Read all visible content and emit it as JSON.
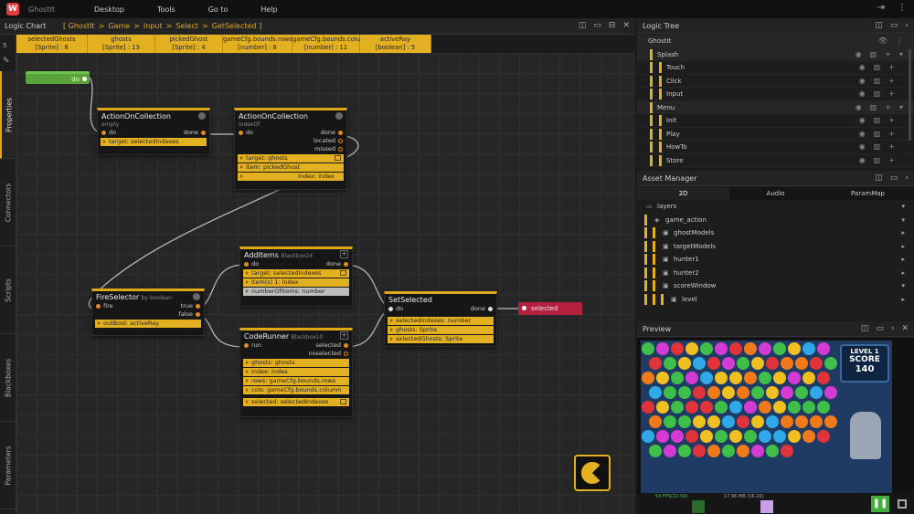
{
  "app": {
    "name": "GhostIt",
    "logo_letter": "W"
  },
  "menu": [
    "Desktop",
    "Tools",
    "Go to",
    "Help"
  ],
  "logic_chart": {
    "title": "Logic Chart",
    "breadcrumb": [
      "[ GhostIt",
      ">",
      "Game",
      ">",
      "Input",
      ">",
      "Select",
      ">",
      "GetSelected ]"
    ]
  },
  "left_tabs": [
    "Properties",
    "Connectors",
    "Scripts",
    "Blackboxes",
    "Parameters"
  ],
  "vars_counter": "5",
  "variables": [
    {
      "name": "selectedGhosts",
      "type": "[Sprite] : 8"
    },
    {
      "name": "ghosts",
      "type": "[Sprite] : 13"
    },
    {
      "name": "pickedGhost",
      "type": "[Sprite] : 4"
    },
    {
      "name": "gameCfg.bounds.rows",
      "type": "[number] : 8"
    },
    {
      "name": "gameCfg.bounds.colu",
      "type": "[number] : 11"
    },
    {
      "name": "activeRay",
      "type": "[boolean] : 5"
    }
  ],
  "nodes": {
    "do": "do",
    "aoc1": {
      "title": "ActionOnCollection",
      "sub": "empty",
      "in": "do",
      "out": "done",
      "param": "target: selectedIndexes"
    },
    "aoc2": {
      "title": "ActionOnCollection",
      "sub": "indexOf",
      "in": "do",
      "outs": [
        "done",
        "located",
        "missed"
      ],
      "params": [
        "target: ghosts",
        "item: pickedGhost"
      ],
      "out_param": "index: index"
    },
    "fire": {
      "title": "FireSelector",
      "sub": "by boolean",
      "in": "fire",
      "outs": [
        "true",
        "false"
      ],
      "param": "outBool: activeRay"
    },
    "additems": {
      "title": "AddItems",
      "sub": "Blackbox24",
      "in": "do",
      "out": "done",
      "params": [
        "target: selectedIndexes",
        "item(s) 1: index"
      ],
      "grey": "numberOfItems: number"
    },
    "coderunner": {
      "title": "CodeRunner",
      "sub": "Blackbox10",
      "in": "run",
      "outs": [
        "selected",
        "noselected"
      ],
      "params": [
        "ghosts: ghosts",
        "index: index",
        "rows: gameCfg.bounds.rows",
        "cols: gameCfg.bounds.column"
      ],
      "out_param": "selected: selectedIndexes"
    },
    "setselected": {
      "title": "SetSelected",
      "in": "do",
      "out": "done",
      "params": [
        "selectedIndexes: number",
        "ghosts: Sprite",
        "selectedGhosts: Sprite"
      ]
    },
    "selected": "selected"
  },
  "logic_tree": {
    "title": "Logic Tree",
    "rows": [
      {
        "label": "GhostIt",
        "level": 0,
        "folder": true
      },
      {
        "label": "Splash",
        "level": 1,
        "folder": true
      },
      {
        "label": "Touch",
        "level": 2
      },
      {
        "label": "Click",
        "level": 2
      },
      {
        "label": "Input",
        "level": 2
      },
      {
        "label": "Menu",
        "level": 1,
        "folder": true
      },
      {
        "label": "Init",
        "level": 2
      },
      {
        "label": "Play",
        "level": 2
      },
      {
        "label": "HowTo",
        "level": 2
      },
      {
        "label": "Store",
        "level": 2
      }
    ]
  },
  "asset_manager": {
    "title": "Asset Manager",
    "tabs": [
      "2D",
      "Audio",
      "ParamMap"
    ],
    "rows": [
      {
        "label": "layers",
        "level": 0
      },
      {
        "label": "game_action",
        "level": 1
      },
      {
        "label": "ghostModels",
        "level": 2
      },
      {
        "label": "targetModels",
        "level": 2
      },
      {
        "label": "hunter1",
        "level": 2
      },
      {
        "label": "hunter2",
        "level": 2
      },
      {
        "label": "scoreWindow",
        "level": 2
      },
      {
        "label": "level",
        "level": 3
      }
    ]
  },
  "preview": {
    "title": "Preview",
    "level_label": "LEVEL",
    "level_value": "1",
    "score_label": "SCORE",
    "score_value": "140",
    "stats_left": "54 FPS(22-59)",
    "stats_right": "17.96 MB (16-20)"
  }
}
